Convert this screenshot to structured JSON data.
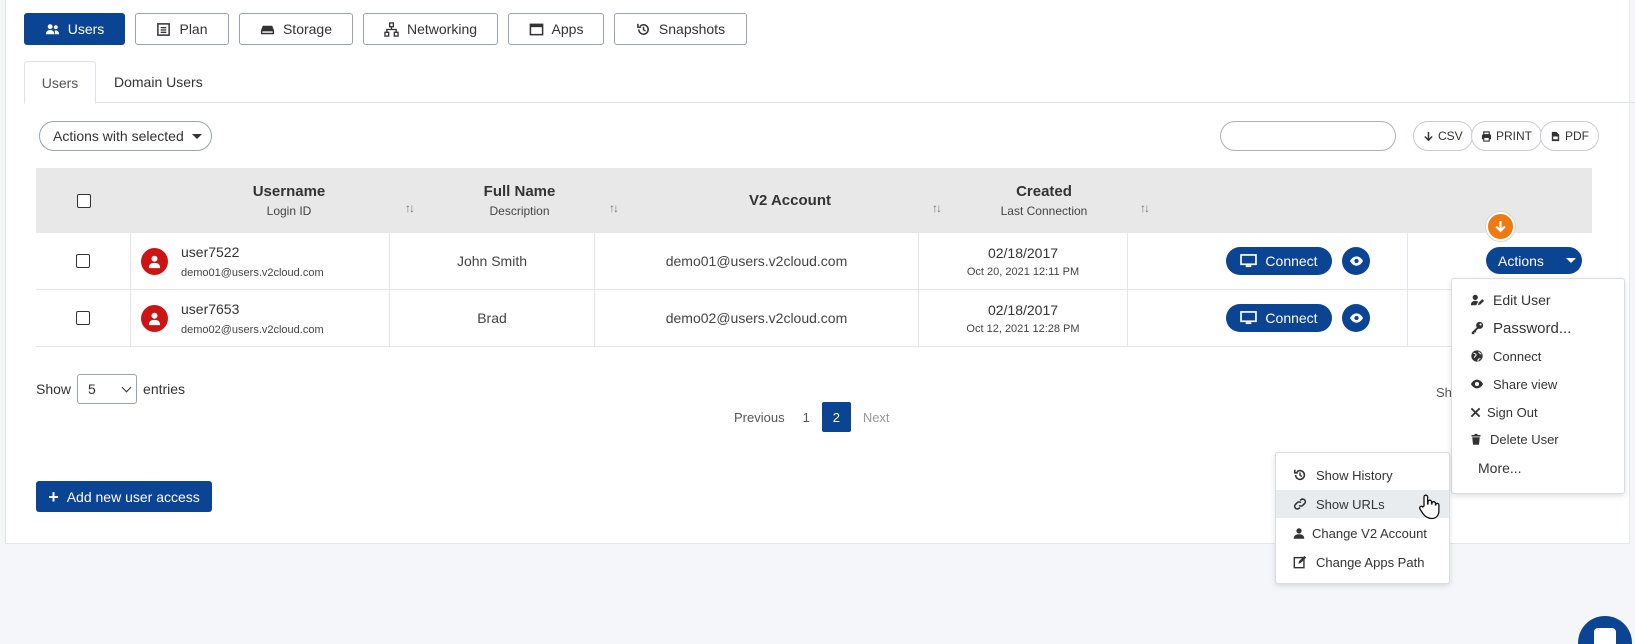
{
  "topnav": [
    {
      "label": "Users",
      "icon": "users-icon",
      "active": true
    },
    {
      "label": "Plan",
      "icon": "list-icon"
    },
    {
      "label": "Storage",
      "icon": "hdd-icon"
    },
    {
      "label": "Networking",
      "icon": "network-icon"
    },
    {
      "label": "Apps",
      "icon": "window-icon"
    },
    {
      "label": "Snapshots",
      "icon": "history-icon"
    }
  ],
  "tabs": [
    {
      "label": "Users",
      "active": true
    },
    {
      "label": "Domain Users"
    }
  ],
  "toolbar": {
    "actions_label": "Actions with selected",
    "search_value": "",
    "csv": "CSV",
    "print": "PRINT",
    "pdf": "PDF"
  },
  "table": {
    "headers": {
      "username": "Username",
      "login_id": "Login ID",
      "full_name": "Full Name",
      "description": "Description",
      "v2_account": "V2 Account",
      "created": "Created",
      "last_connection": "Last Connection"
    },
    "rows": [
      {
        "username": "user7522",
        "login": "demo01@users.v2cloud.com",
        "full_name": "John Smith",
        "v2_account": "demo01@users.v2cloud.com",
        "created": "02/18/2017",
        "last_connection": "Oct 20, 2021 12:11 PM"
      },
      {
        "username": "user7653",
        "login": "demo02@users.v2cloud.com",
        "full_name": "Brad",
        "v2_account": "demo02@users.v2cloud.com",
        "created": "02/18/2017",
        "last_connection": "Oct 12, 2021 12:28 PM"
      }
    ],
    "connect_label": "Connect",
    "actions_label": "Actions"
  },
  "footer": {
    "show_label": "Show",
    "entries_value": "5",
    "entries_label": "entries",
    "showing_fragment": "Sh",
    "pager": {
      "previous": "Previous",
      "page1": "1",
      "page2": "2",
      "next": "Next"
    },
    "add_button": "Add new user access"
  },
  "actions_menu": [
    {
      "label": "Edit User",
      "icon": "user-edit-icon"
    },
    {
      "label": "Password...",
      "icon": "key-icon"
    },
    {
      "label": "Connect",
      "icon": "globe-icon"
    },
    {
      "label": "Share view",
      "icon": "eye-icon"
    },
    {
      "label": "Sign Out",
      "icon": "x-icon"
    },
    {
      "label": "Delete User",
      "icon": "trash-icon"
    },
    {
      "label": "More...",
      "icon": ""
    }
  ],
  "more_menu": [
    {
      "label": "Show History",
      "icon": "history-icon"
    },
    {
      "label": "Show URLs",
      "icon": "link-icon",
      "hover": true
    },
    {
      "label": "Change V2 Account",
      "icon": "user-icon"
    },
    {
      "label": "Change Apps Path",
      "icon": "edit-icon"
    }
  ],
  "colors": {
    "primary": "#0b4493",
    "avatar": "#cc1414",
    "orange": "#f07a12"
  }
}
